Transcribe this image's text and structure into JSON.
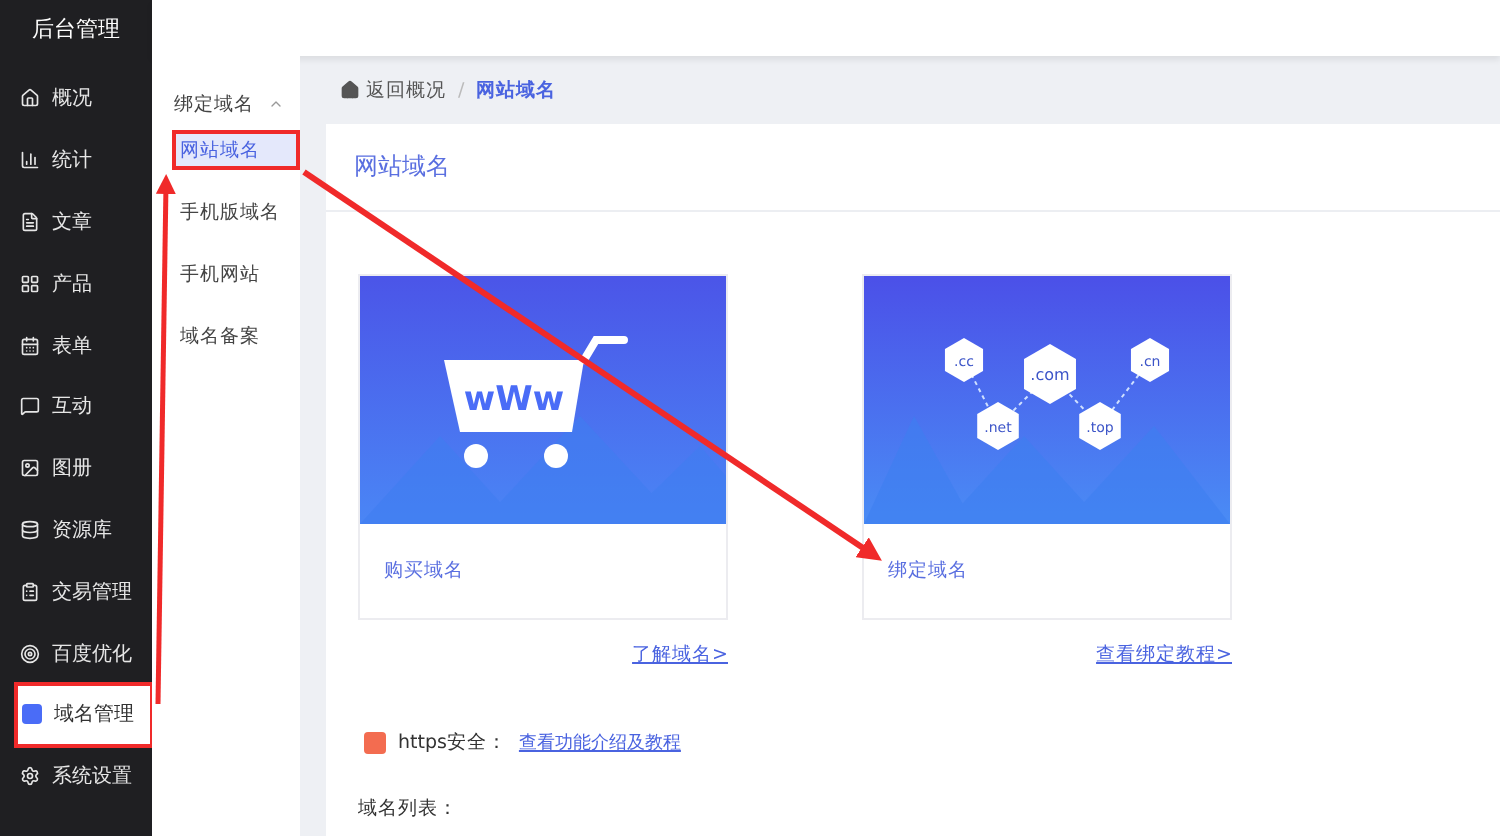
{
  "sidebar": {
    "title": "后台管理",
    "items": [
      {
        "label": "概况",
        "selected": false,
        "annotated": false
      },
      {
        "label": "统计",
        "selected": false,
        "annotated": false
      },
      {
        "label": "文章",
        "selected": false,
        "annotated": false
      },
      {
        "label": "产品",
        "selected": false,
        "annotated": false
      },
      {
        "label": "表单",
        "selected": false,
        "annotated": false
      },
      {
        "label": "互动",
        "selected": false,
        "annotated": false
      },
      {
        "label": "图册",
        "selected": false,
        "annotated": false
      },
      {
        "label": "资源库",
        "selected": false,
        "annotated": false
      },
      {
        "label": "交易管理",
        "selected": false,
        "annotated": false
      },
      {
        "label": "百度优化",
        "selected": false,
        "annotated": false
      },
      {
        "label": "域名管理",
        "selected": true,
        "annotated": true
      },
      {
        "label": "系统设置",
        "selected": false,
        "annotated": false
      }
    ]
  },
  "submenu": {
    "group": "绑定域名",
    "expanded": true,
    "items": [
      {
        "label": "网站域名",
        "selected": true,
        "annotated": true
      },
      {
        "label": "手机版域名",
        "selected": false,
        "annotated": false
      },
      {
        "label": "手机网站",
        "selected": false,
        "annotated": false
      },
      {
        "label": "域名备案",
        "selected": false,
        "annotated": false
      }
    ]
  },
  "breadcrumb": {
    "home": "返回概况",
    "separator": "/",
    "current": "网站域名"
  },
  "panel_title": "网站域名",
  "cards": [
    {
      "kind": "shop",
      "art_text": "wWw",
      "label": "购买域名",
      "link": "了解域名>"
    },
    {
      "kind": "network",
      "art_tags": [
        ".cc",
        ".com",
        ".cn",
        ".net",
        ".top"
      ],
      "label": "绑定域名",
      "link": "查看绑定教程>"
    }
  ],
  "https": {
    "label": "https安全：",
    "link": "查看功能介绍及教程"
  },
  "list_label": "域名列表："
}
